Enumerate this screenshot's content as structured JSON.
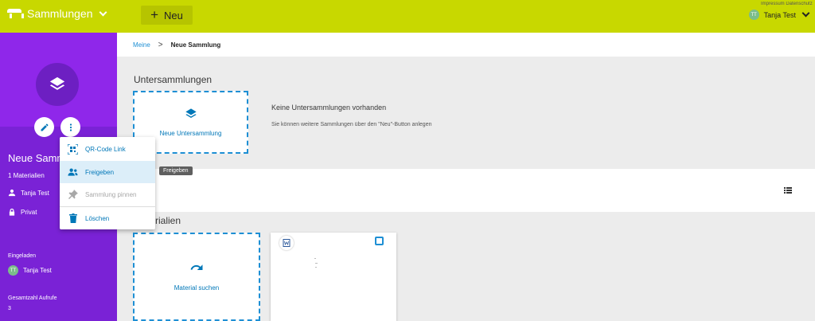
{
  "topbar": {
    "brand": "Sammlungen",
    "new_button": "Neu",
    "links": "Impressum  Datenschutz",
    "user_initials": "TT",
    "user_name": "Tanja Test"
  },
  "sidebar": {
    "title": "Neue Samm",
    "count": "1 Materialien",
    "owner": "Tanja Test",
    "scope": "Privat",
    "invited_label": "Eingeladen",
    "invited_initials": "TT",
    "invited_user": "Tanja Test",
    "views_label": "Gesamtzahl Aufrufe",
    "views_value": "3"
  },
  "breadcrumb": {
    "root": "Meine",
    "separator": ">",
    "current": "Neue Sammlung"
  },
  "subcollections": {
    "heading": "Untersammlungen",
    "new_label": "Neue Untersammlung",
    "empty_title": "Keine Untersammlungen vorhanden",
    "empty_text": "Sie können weitere Sammlungen über den \"Neu\"-Button anlegen"
  },
  "materials": {
    "heading": "rialien",
    "search_label": "Material suchen"
  },
  "menu": {
    "items": [
      {
        "label": "QR-Code Link",
        "icon": "qr-code-icon"
      },
      {
        "label": "Freigeben",
        "icon": "share-people-icon"
      },
      {
        "label": "Sammlung pinnen",
        "icon": "pin-icon"
      },
      {
        "label": "Löschen",
        "icon": "trash-icon"
      }
    ],
    "tooltip": "Freigeben"
  },
  "colors": {
    "topbar": "#c8d800",
    "sidebar": "#7a22d6",
    "accent": "#1e8fd4"
  }
}
